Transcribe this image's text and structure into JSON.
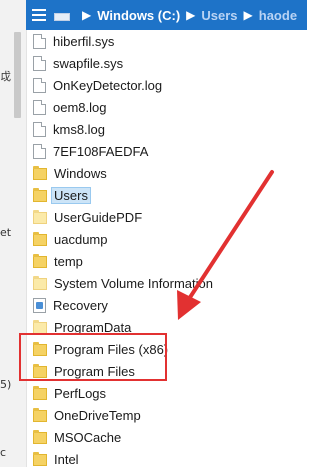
{
  "address_bar": {
    "crumbs": [
      "Windows (C:)",
      "Users",
      "haode"
    ]
  },
  "left_panel_fragments": [
    "戉",
    "et",
    "5)",
    "c"
  ],
  "files": [
    {
      "name": "hiberfil.sys",
      "icon": "file-icon"
    },
    {
      "name": "swapfile.sys",
      "icon": "file-icon"
    },
    {
      "name": "OnKeyDetector.log",
      "icon": "file-icon"
    },
    {
      "name": "oem8.log",
      "icon": "file-icon"
    },
    {
      "name": "kms8.log",
      "icon": "file-icon"
    },
    {
      "name": "7EF108FAEDFA",
      "icon": "file-icon"
    },
    {
      "name": "Windows",
      "icon": "folder-icon"
    },
    {
      "name": "Users",
      "icon": "folder-icon",
      "selected": true
    },
    {
      "name": "UserGuidePDF",
      "icon": "folder-icon"
    },
    {
      "name": "uacdump",
      "icon": "folder-icon"
    },
    {
      "name": "temp",
      "icon": "folder-icon"
    },
    {
      "name": "System Volume Information",
      "icon": "folder-icon"
    },
    {
      "name": "Recovery",
      "icon": "recovery-icon"
    },
    {
      "name": "ProgramData",
      "icon": "folder-icon"
    },
    {
      "name": "Program Files (x86)",
      "icon": "folder-icon"
    },
    {
      "name": "Program Files",
      "icon": "folder-icon"
    },
    {
      "name": "PerfLogs",
      "icon": "folder-icon"
    },
    {
      "name": "OneDriveTemp",
      "icon": "folder-icon"
    },
    {
      "name": "MSOCache",
      "icon": "folder-icon"
    },
    {
      "name": "Intel",
      "icon": "folder-icon"
    }
  ],
  "colors": {
    "title_bar": "#1e73c8",
    "highlight": "#e23131",
    "selection": "#cce4f7"
  }
}
